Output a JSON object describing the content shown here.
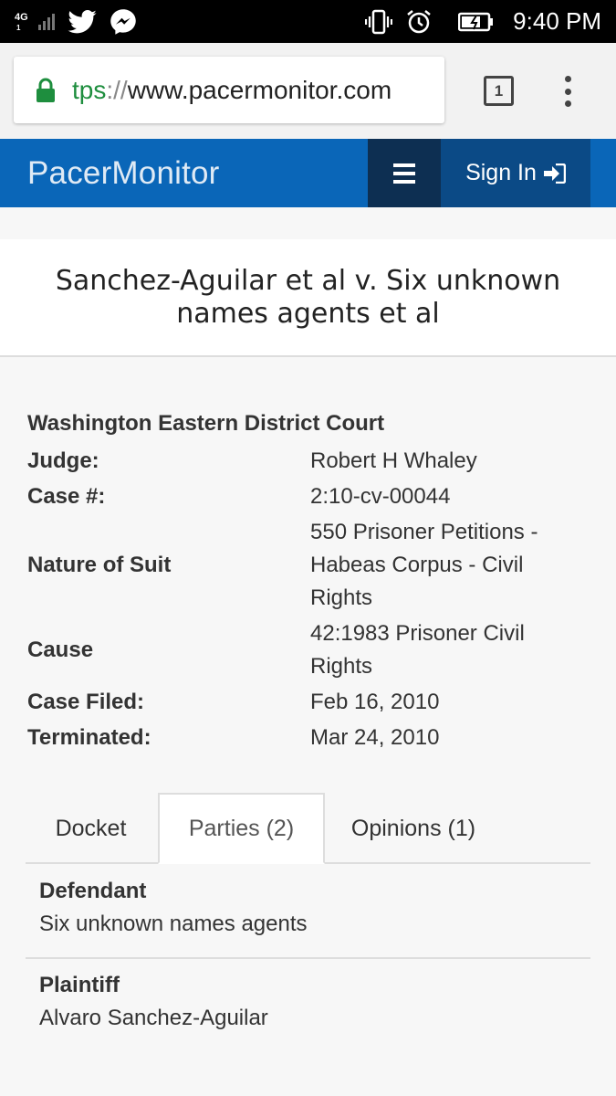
{
  "status_bar": {
    "network_type": "4G",
    "network_sub": "1",
    "time": "9:40 PM",
    "icons": [
      "signal-icon",
      "twitter-icon",
      "messenger-icon",
      "vibrate-icon",
      "alarm-icon",
      "battery-icon"
    ]
  },
  "browser": {
    "url_scheme": "tps",
    "url_separator": "://",
    "url_host": "www.pacermonitor.com",
    "tab_count": "1"
  },
  "site": {
    "brand": "PacerMonitor",
    "signin_label": "Sign In",
    "brand_color": "#0a66b8"
  },
  "case": {
    "title": "Sanchez-Aguilar et al v. Six unknown names agents et al",
    "court": "Washington Eastern District Court",
    "details": [
      {
        "label": "Judge:",
        "value": "Robert H Whaley"
      },
      {
        "label": "Case #:",
        "value": "2:10-cv-00044"
      },
      {
        "label": "Nature of Suit",
        "value": "550 Prisoner Petitions - Habeas Corpus - Civil Rights"
      },
      {
        "label": "Cause",
        "value": "42:1983 Prisoner Civil Rights"
      },
      {
        "label": "Case Filed:",
        "value": "Feb 16, 2010"
      },
      {
        "label": "Terminated:",
        "value": "Mar 24, 2010"
      }
    ]
  },
  "tabs": [
    {
      "label": "Docket"
    },
    {
      "label": "Parties (2)"
    },
    {
      "label": "Opinions (1)"
    }
  ],
  "parties": [
    {
      "role": "Defendant",
      "name": "Six unknown names agents"
    },
    {
      "role": "Plaintiff",
      "name": "Alvaro Sanchez-Aguilar"
    }
  ]
}
